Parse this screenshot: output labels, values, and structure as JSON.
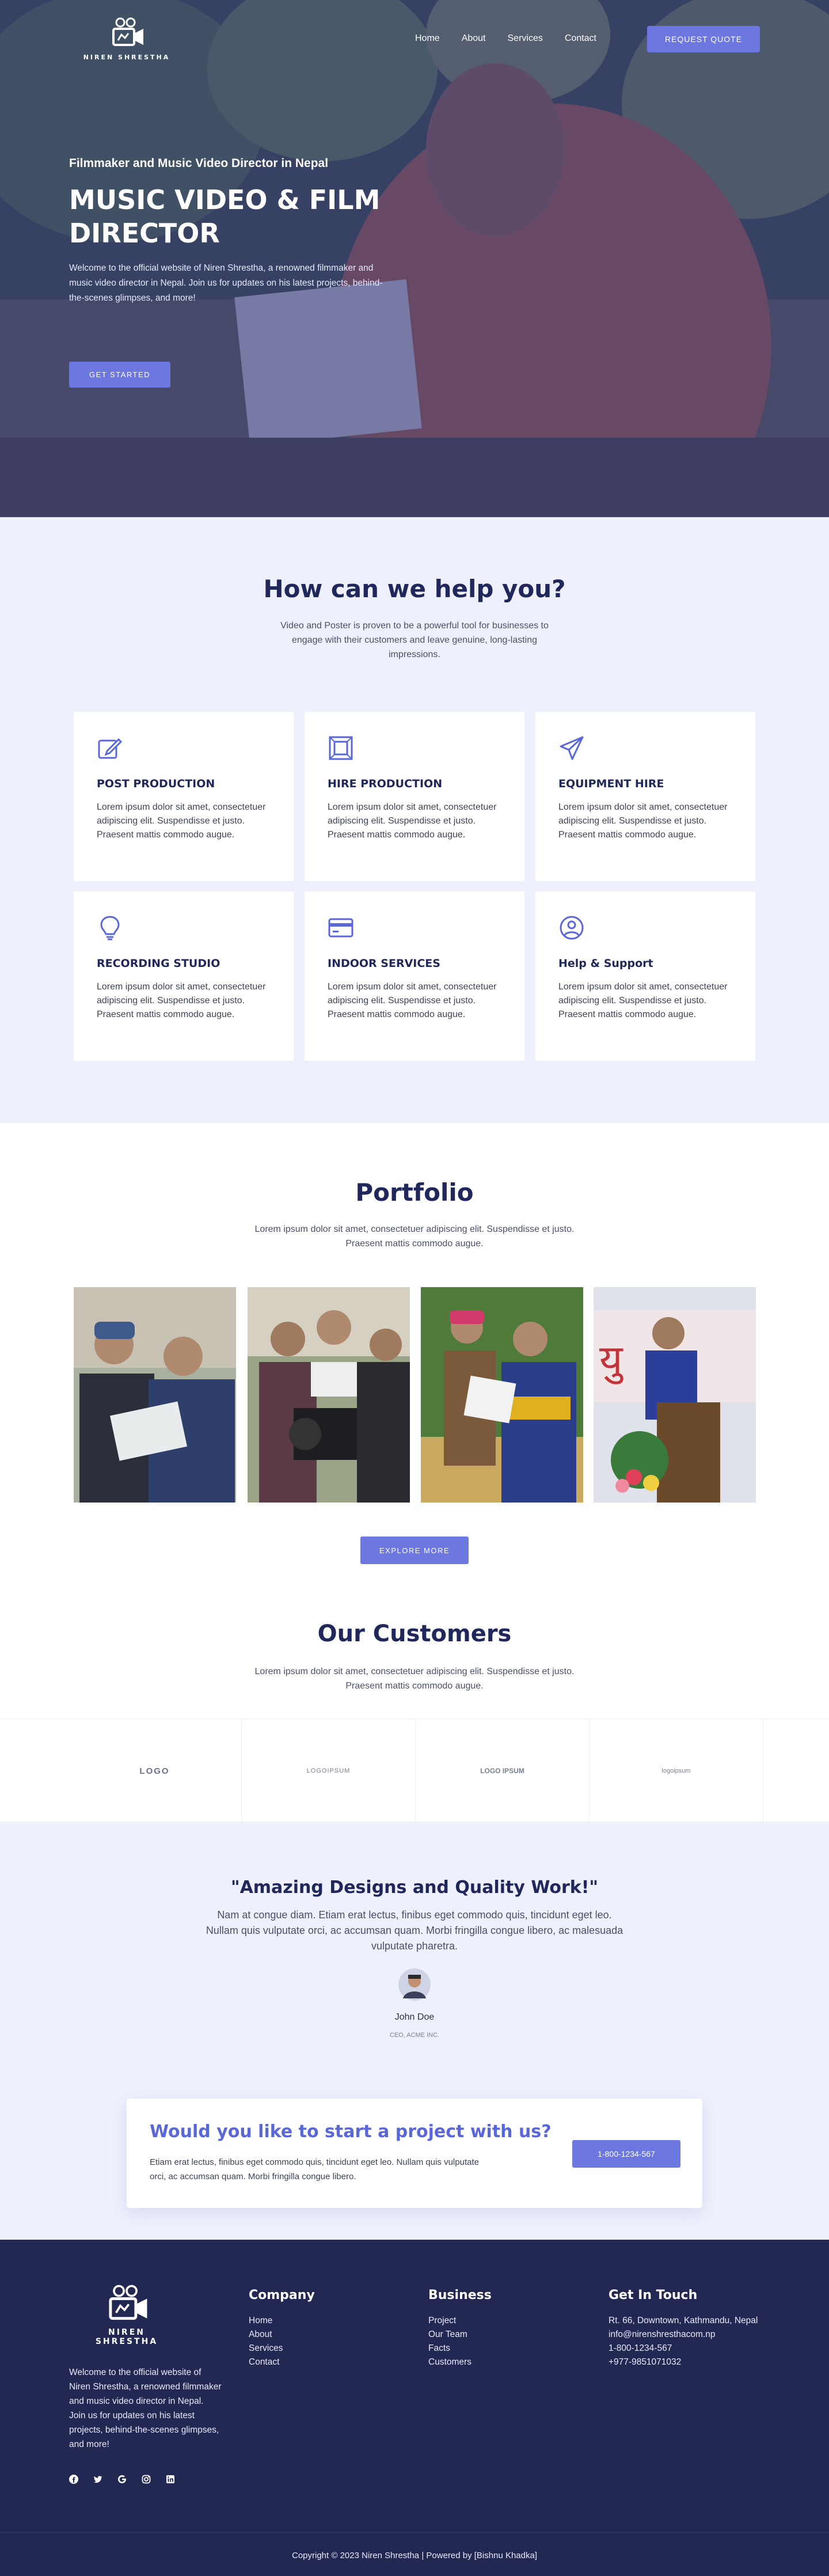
{
  "header": {
    "logo_text": "NIREN SHRESTHA",
    "nav": [
      "Home",
      "About",
      "Services",
      "Contact"
    ],
    "quote_button": "REQUEST QUOTE"
  },
  "hero": {
    "subtitle": "Filmmaker and Music Video Director in Nepal",
    "title": "MUSIC VIDEO & FILM DIRECTOR",
    "description": "Welcome to the official website of Niren Shrestha, a renowned filmmaker and music video director in Nepal. Join us for updates on his latest projects, behind-the-scenes glimpses, and more!",
    "button": "GET STARTED"
  },
  "help": {
    "title": "How can we help you?",
    "description": "Video and Poster is proven to be a powerful tool for businesses to engage with their customers and leave genuine, long-lasting impressions.",
    "cards": [
      {
        "icon": "pencil-square-icon",
        "title": "POST PRODUCTION",
        "text": "Lorem ipsum dolor sit amet, consectetuer adipiscing elit. Suspendisse et justo. Praesent mattis commodo augue."
      },
      {
        "icon": "frame-icon",
        "title": "HIRE PRODUCTION",
        "text": "Lorem ipsum dolor sit amet, consectetuer adipiscing elit. Suspendisse et justo. Praesent mattis commodo augue."
      },
      {
        "icon": "paper-plane-icon",
        "title": "EQUIPMENT HIRE",
        "text": "Lorem ipsum dolor sit amet, consectetuer adipiscing elit. Suspendisse et justo. Praesent mattis commodo augue."
      },
      {
        "icon": "lightbulb-icon",
        "title": "RECORDING STUDIO",
        "text": "Lorem ipsum dolor sit amet, consectetuer adipiscing elit. Suspendisse et justo. Praesent mattis commodo augue."
      },
      {
        "icon": "credit-card-icon",
        "title": "INDOOR SERVICES",
        "text": "Lorem ipsum dolor sit amet, consectetuer adipiscing elit. Suspendisse et justo. Praesent mattis commodo augue."
      },
      {
        "icon": "user-circle-icon",
        "title": "Help & Support",
        "text": "Lorem ipsum dolor sit amet, consectetuer adipiscing elit. Suspendisse et justo. Praesent mattis commodo augue."
      }
    ]
  },
  "portfolio": {
    "title": "Portfolio",
    "description": "Lorem ipsum dolor sit amet, consectetuer adipiscing elit. Suspendisse et justo. Praesent mattis commodo augue.",
    "button": "EXPLORE MORE"
  },
  "customers": {
    "title": "Our Customers",
    "description": "Lorem ipsum dolor sit amet, consectetuer adipiscing elit. Suspendisse et justo. Praesent mattis commodo augue.",
    "logos": [
      "LOGO",
      "LOGOIPSUM",
      "LOGO IPSUM",
      "logoipsum"
    ]
  },
  "testimonial": {
    "quote": "\"Amazing Designs and Quality Work!\"",
    "text": "Nam at congue diam. Etiam erat lectus, finibus eget commodo quis, tincidunt eget leo. Nullam quis vulputate orci, ac accumsan quam. Morbi fringilla congue libero, ac malesuada vulputate pharetra.",
    "name": "John Doe",
    "role": "CEO, ACME INC."
  },
  "cta": {
    "title": "Would you like to start a project with us?",
    "text": "Etiam erat lectus, finibus eget commodo quis, tincidunt eget leo. Nullam quis vulputate orci, ac accumsan quam. Morbi fringilla congue libero.",
    "button": "1-800-1234-567"
  },
  "footer": {
    "logo_text": "NIREN SHRESTHA",
    "about": "Welcome to the official website of Niren Shrestha, a renowned filmmaker and music video director in Nepal. Join us for updates on his latest projects, behind-the-scenes glimpses, and more!",
    "company": {
      "title": "Company",
      "links": [
        "Home",
        "About",
        "Services",
        "Contact"
      ]
    },
    "business": {
      "title": "Business",
      "links": [
        "Project",
        "Our Team",
        "Facts",
        "Customers"
      ]
    },
    "contact": {
      "title": "Get In Touch",
      "lines": [
        "Rt. 66, Downtown, Kathmandu, Nepal",
        "info@nirenshresthacom.np",
        "1-800-1234-567",
        "+977-9851071032"
      ]
    },
    "social": [
      "facebook-icon",
      "twitter-icon",
      "google-icon",
      "instagram-icon",
      "linkedin-icon"
    ],
    "copyright": "Copyright © 2023 Niren Shrestha | Powered by [Bishnu Khadka]"
  },
  "colors": {
    "accent": "#6c78e0",
    "navy": "#232852",
    "light_bg": "#eef0fd",
    "heading": "#20275a"
  }
}
